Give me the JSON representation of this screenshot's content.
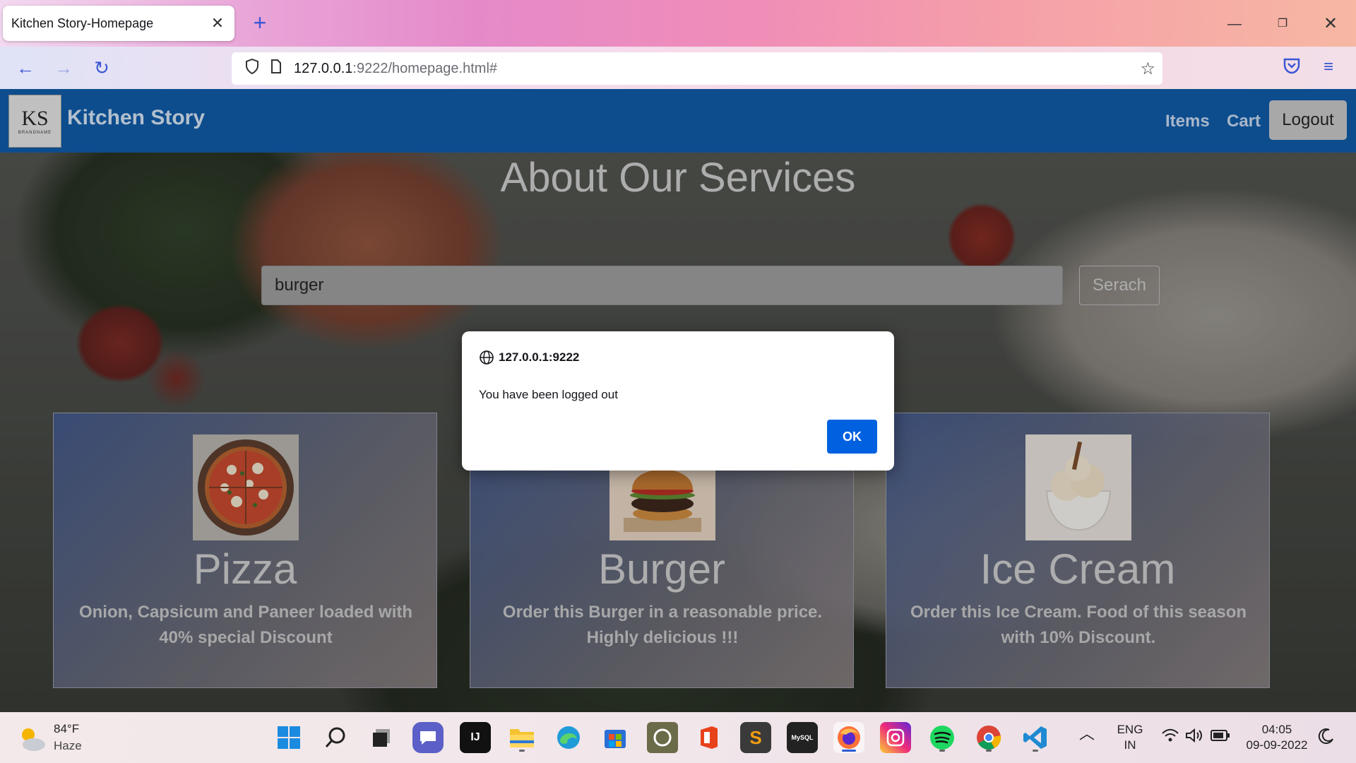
{
  "browser": {
    "tab_title": "Kitchen Story-Homepage",
    "tab_close": "✕",
    "new_tab": "+",
    "url_host": "127.0.0.1",
    "url_path": ":9222/homepage.html#"
  },
  "site": {
    "logo_mark": "KS",
    "logo_sub": "BRANDNAME",
    "brand": "Kitchen Story",
    "nav": {
      "items": "Items",
      "cart": "Cart",
      "logout": "Logout"
    },
    "hero_title": "About Our Services",
    "search": {
      "value": "burger",
      "button": "Serach"
    },
    "cards": [
      {
        "title": "Pizza",
        "desc": "Onion, Capsicum and Paneer loaded with 40% special Discount"
      },
      {
        "title": "Burger",
        "desc": "Order this Burger in a reasonable price. Highly delicious !!!"
      },
      {
        "title": "Ice Cream",
        "desc": "Order this Ice Cream. Food of this season with 10% Discount."
      }
    ]
  },
  "dialog": {
    "origin": "127.0.0.1:9222",
    "message": "You have been logged out",
    "ok": "OK"
  },
  "taskbar": {
    "weather_temp": "84°F",
    "weather_desc": "Haze",
    "lang_top": "ENG",
    "lang_bottom": "IN",
    "time": "04:05",
    "date": "09-09-2022"
  },
  "colors": {
    "header_blue": "#0b5aa8",
    "dialog_ok": "#0061e0",
    "accent": "#3a56d4"
  }
}
